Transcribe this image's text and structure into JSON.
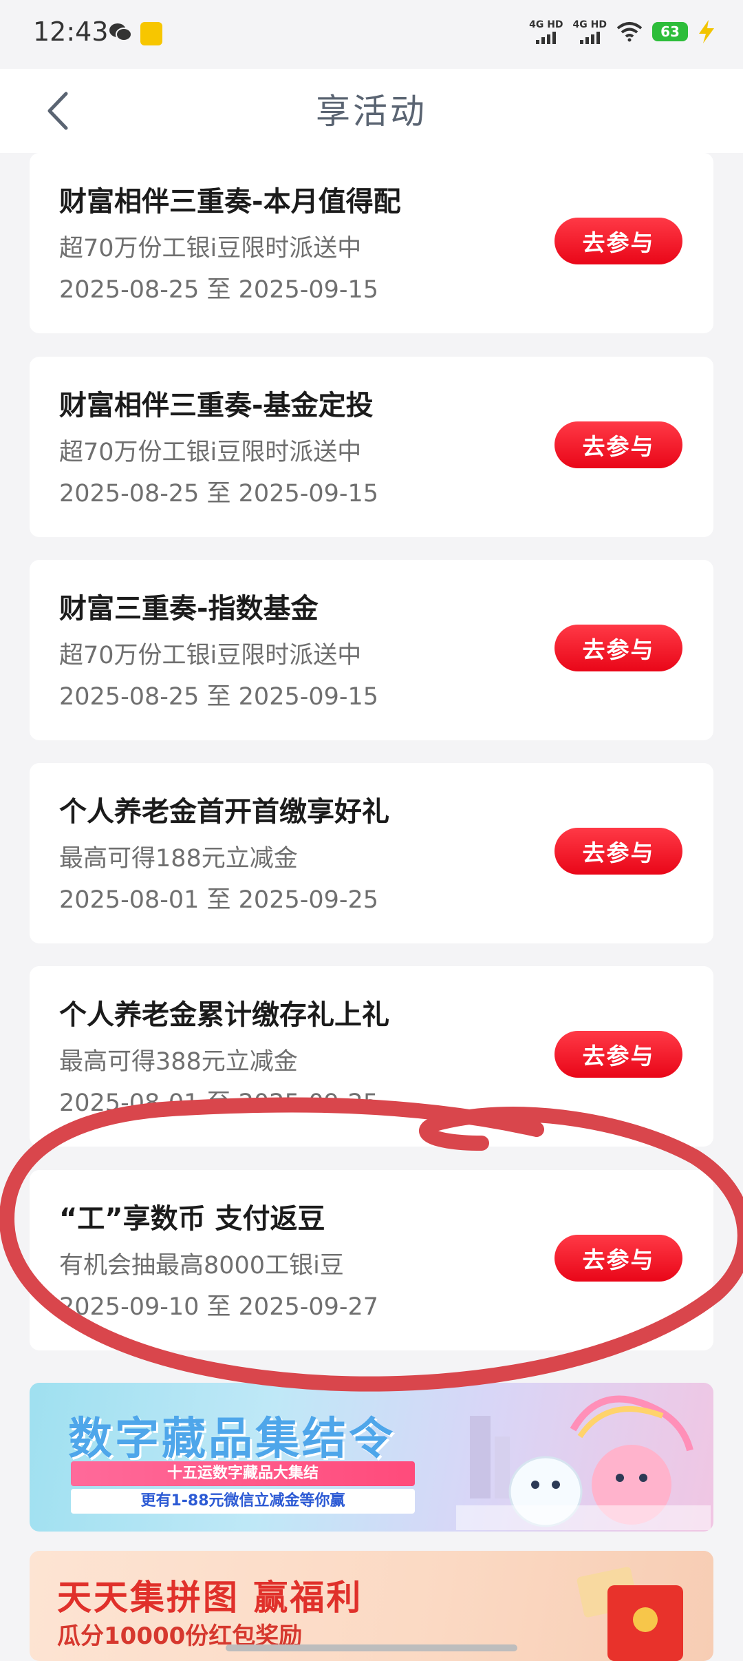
{
  "status_bar": {
    "time": "12:43",
    "signal1_label": "4G HD",
    "signal2_label": "4G HD",
    "battery": "63"
  },
  "header": {
    "title": "享活动"
  },
  "join_label": "去参与",
  "activities": [
    {
      "title": "财富相伴三重奏-本月值得配",
      "desc": "超70万份工银i豆限时派送中",
      "date": "2025-08-25 至 2025-09-15"
    },
    {
      "title": "财富相伴三重奏-基金定投",
      "desc": "超70万份工银i豆限时派送中",
      "date": "2025-08-25 至 2025-09-15"
    },
    {
      "title": "财富三重奏-指数基金",
      "desc": "超70万份工银i豆限时派送中",
      "date": "2025-08-25 至 2025-09-15"
    },
    {
      "title": "个人养老金首开首缴享好礼",
      "desc": "最高可得188元立减金",
      "date": "2025-08-01 至 2025-09-25"
    },
    {
      "title": "个人养老金累计缴存礼上礼",
      "desc": "最高可得388元立减金",
      "date": "2025-08-01 至 2025-09-25"
    },
    {
      "title": "“工”享数币 支付返豆",
      "desc": "有机会抽最高8000工银i豆",
      "date": "2025-09-10 至 2025-09-27"
    }
  ],
  "banners": {
    "digital": {
      "title": "数字藏品集结令",
      "line1": "十五运数字藏品大集结",
      "line2": "更有1-88元微信立减金等你赢"
    },
    "puzzle": {
      "title": "天天集拼图 赢福利",
      "subtitle": "瓜分10000份红包奖励"
    }
  },
  "colors": {
    "accent": "#e90618",
    "annotation": "#d9464c"
  }
}
